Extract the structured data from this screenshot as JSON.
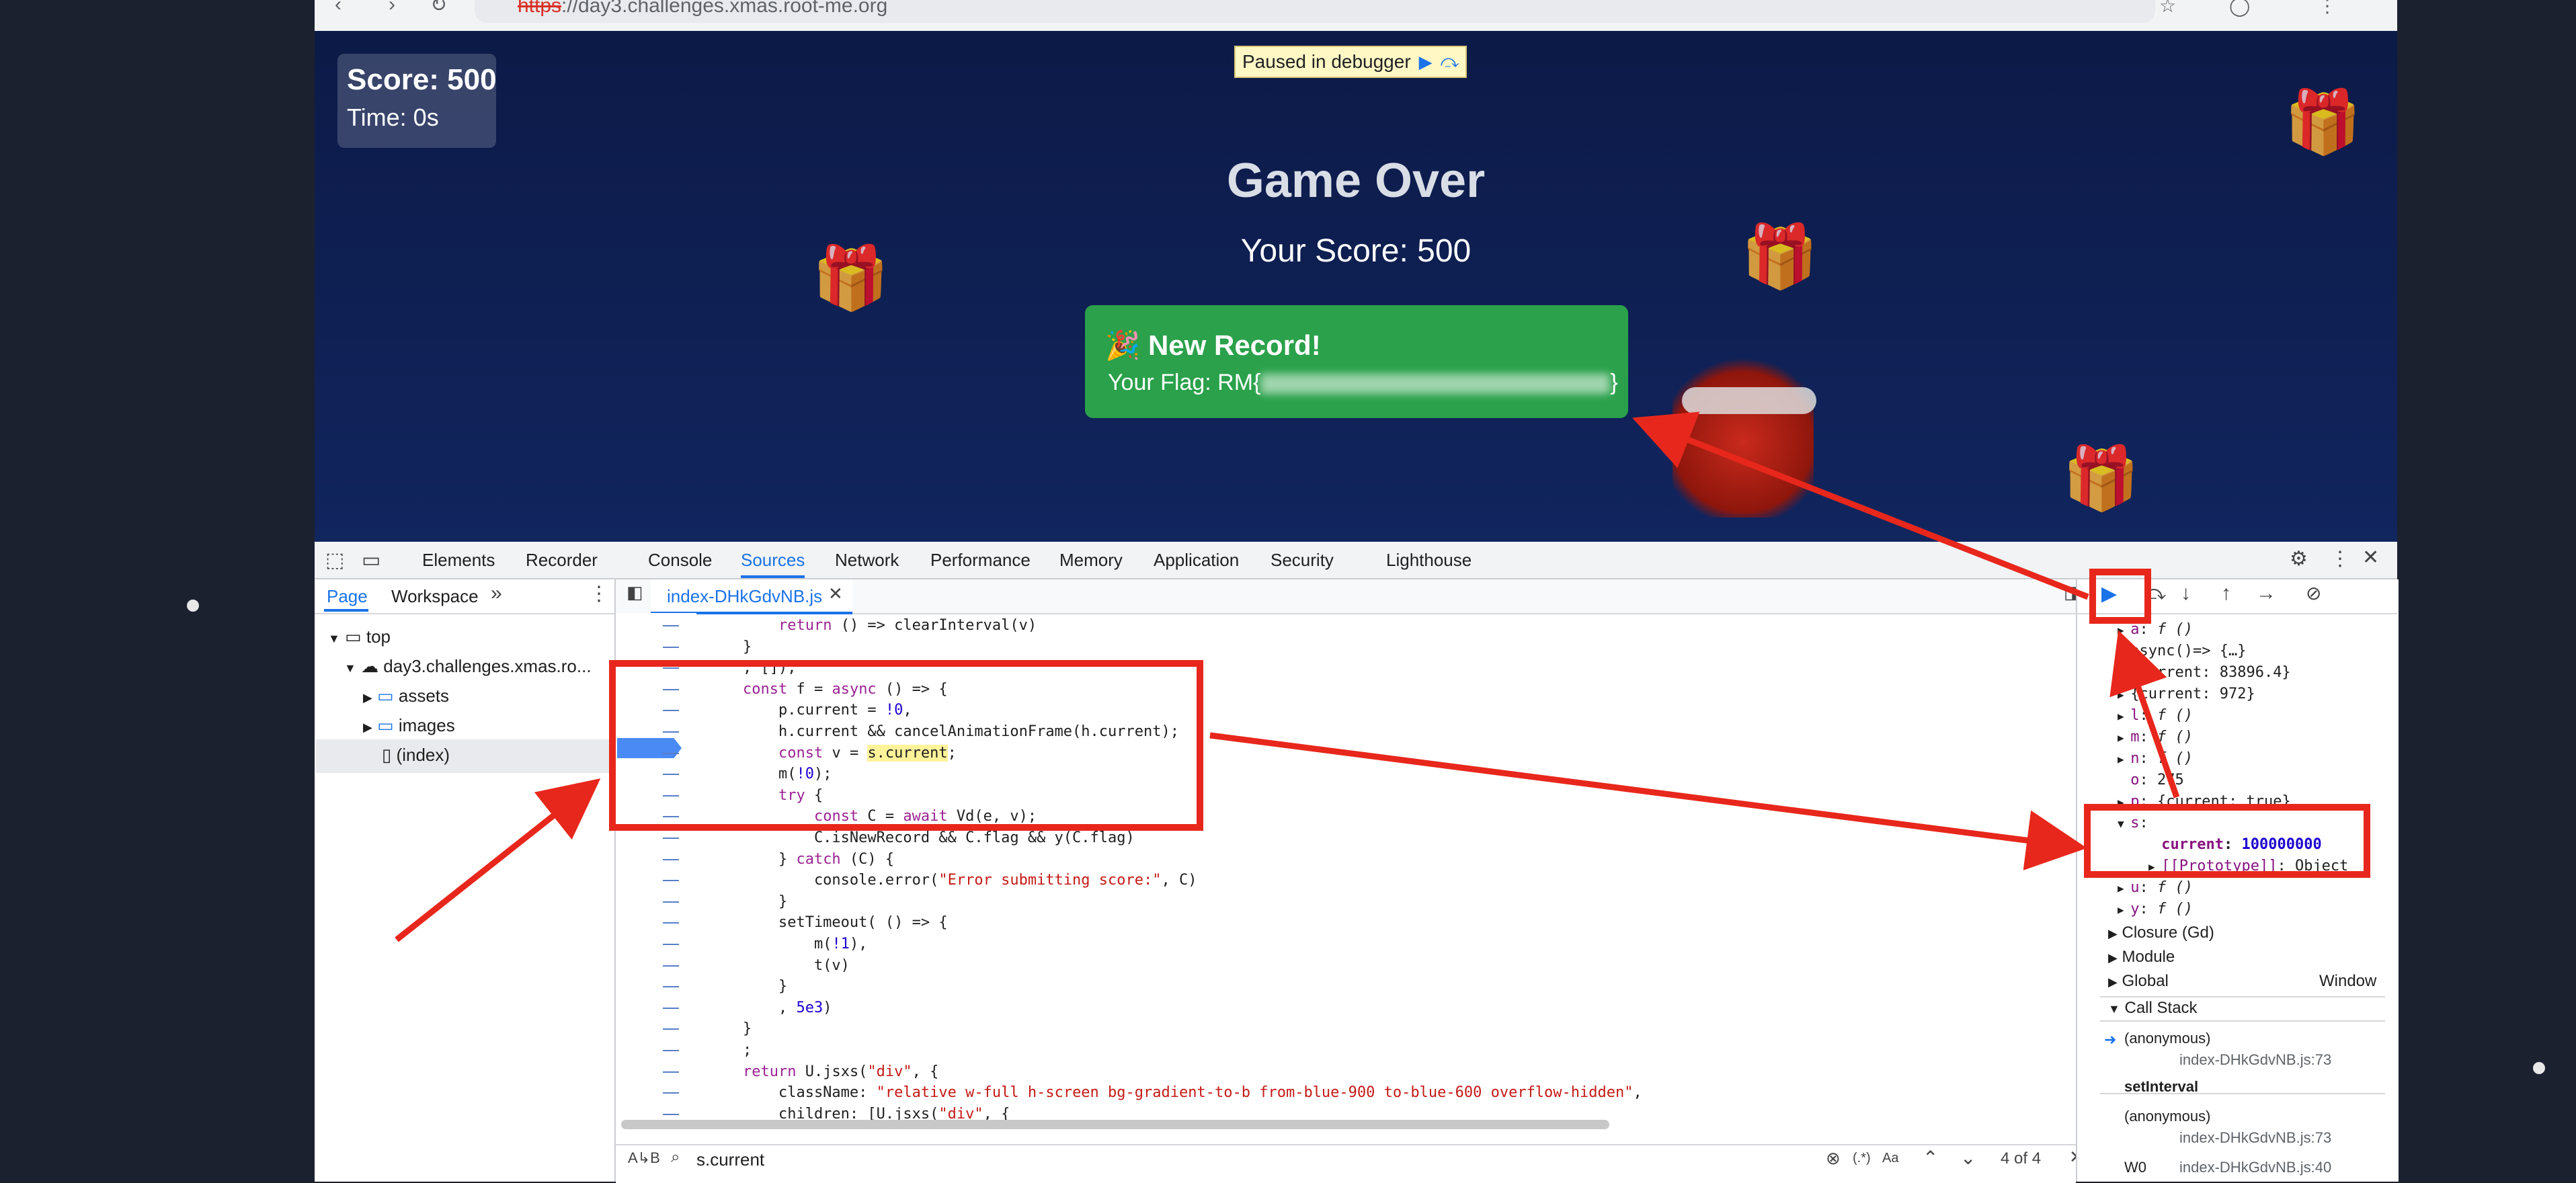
{
  "browser": {
    "url_scheme": "https",
    "url_rest": "://day3.challenges.xmas.root-me.org",
    "back_glyph": "‹",
    "forward_glyph": "›",
    "reload_glyph": "↻"
  },
  "game": {
    "score_label": "Score: 500",
    "time_label": "Time: 0s",
    "paused_text": "Paused in debugger",
    "title": "Game Over",
    "your_score": "Your Score: 500",
    "record_title": "🎉 New Record!",
    "flag_prefix": "Your Flag: RM{",
    "flag_suffix": "}"
  },
  "devtools": {
    "tabs": [
      "Elements",
      "Recorder",
      "Console",
      "Sources",
      "Network",
      "Performance",
      "Memory",
      "Application",
      "Security",
      "Lighthouse"
    ],
    "active_tab": "Sources",
    "navigator_tabs": [
      "Page",
      "Workspace"
    ],
    "more_glyph": "»",
    "tree": {
      "top": "top",
      "domain": "day3.challenges.xmas.ro...",
      "assets": "assets",
      "images": "images",
      "index": "(index)"
    },
    "editor_file": "index-DHkGdvNB.js",
    "code_lines": [
      "        return () => clearInterval(v)",
      "    }",
      "    , []);",
      "    const f = async () => {",
      "        p.current = !0,",
      "        h.current && cancelAnimationFrame(h.current);",
      "        const v = s.current;",
      "        m(!0);",
      "        try {",
      "            const C = await Vd(e, v);",
      "            C.isNewRecord && C.flag && y(C.flag)",
      "        } catch (C) {",
      "            console.error(\"Error submitting score:\", C)",
      "        }",
      "        setTimeout( () => {",
      "            m(!1),",
      "            t(v)",
      "        }",
      "        , 5e3)",
      "    }",
      "    ;",
      "    return U.jsxs(\"div\", {",
      "        className: \"relative w-full h-screen bg-gradient-to-b from-blue-900 to-blue-600 overflow-hidden\",",
      "        children: [U.jsxs(\"div\", {"
    ],
    "search": {
      "query": "s.current",
      "regex_label": "(.*)",
      "case_label": "Aa",
      "match_count": "4 of 4"
    },
    "scope": [
      {
        "key": "a",
        "val": "f ()"
      },
      {
        "key": "",
        "val": "async()=> {…}"
      },
      {
        "key": "",
        "val": "{current: 83896.4}"
      },
      {
        "key": "",
        "val": "{current: 972}"
      },
      {
        "key": "l",
        "val": "f ()"
      },
      {
        "key": "m",
        "val": "f ()"
      },
      {
        "key": "n",
        "val": "f ()"
      },
      {
        "key": "o",
        "val": "275"
      },
      {
        "key": "p",
        "val": "{current: true}"
      },
      {
        "key": "s",
        "val": ""
      },
      {
        "key": "current",
        "val": "100000000"
      },
      {
        "key": "[[Prototype]]",
        "val": "Object"
      },
      {
        "key": "u",
        "val": "f ()"
      },
      {
        "key": "y",
        "val": "f ()"
      }
    ],
    "closure_label": "Closure (Gd)",
    "module_label": "Module",
    "global_label": "Global",
    "global_value": "Window",
    "call_stack_label": "Call Stack",
    "call_stack": [
      {
        "name": "(anonymous)",
        "file": "index-DHkGdvNB.js:73"
      },
      {
        "name": "setInterval",
        "file": ""
      },
      {
        "name": "(anonymous)",
        "file": "index-DHkGdvNB.js:73"
      },
      {
        "name": "W0",
        "file": "index-DHkGdvNB.js:40"
      }
    ]
  },
  "colors": {
    "annotation_red": "#e8271c",
    "record_green": "#2aa14a",
    "devtools_blue": "#1a73e8"
  }
}
